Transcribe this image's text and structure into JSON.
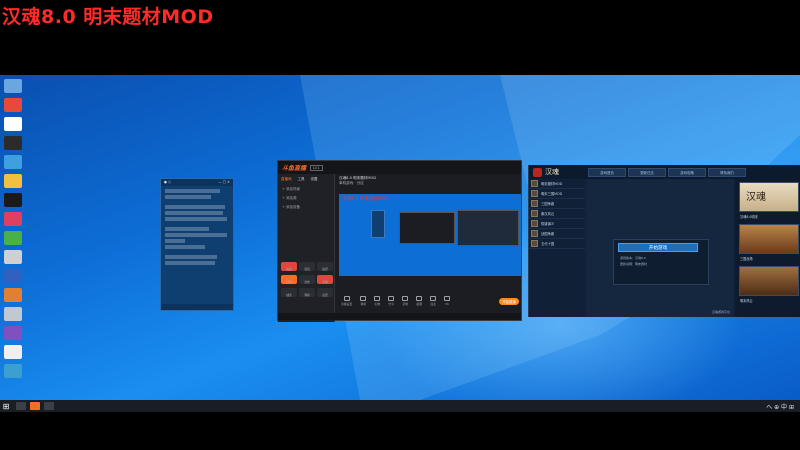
{
  "overlay": {
    "title": "汉魂8.0 明末题材MOD"
  },
  "taskbar": {
    "tray_text": "へ ⊕ 中 ⊞"
  },
  "chat": {
    "header_left": "● ○",
    "header_right": "— □ ✕"
  },
  "stream_app": {
    "logo": "斗鱼直播",
    "badge": "LV.1",
    "side_tabs": [
      "直播间",
      "工具",
      "设置"
    ],
    "side_rows": [
      "+ 添加场景",
      "+ 添加源",
      "+ 添加设备"
    ],
    "tools": [
      "美颜",
      "滤镜",
      "贴纸",
      "特效",
      "音效",
      "录像",
      "抽奖",
      "弹幕",
      "设置"
    ],
    "main_title": "汉魂8.0 明末题材MOD",
    "main_meta": "单机游戏 · 分区",
    "preview_text": "汉魂8.0 明末题材MOD",
    "bottom_tools": [
      "直播设置",
      "弹幕",
      "礼物",
      "分享",
      "录制",
      "截图",
      "连麦",
      "PK"
    ],
    "go_live": "开始直播"
  },
  "launcher": {
    "title": "汉魂",
    "nav": [
      "游戏首页",
      "更新日志",
      "游戏攻略",
      "联系我们"
    ],
    "side_items": [
      "明末题材MOD",
      "明末三国MOD",
      "三国争霸",
      "秦汉风云",
      "隋唐演义",
      "战国争霸",
      "五代十国"
    ],
    "start_button": "开始游戏",
    "rows": [
      "游戏版本：汉魂8.0",
      "更新说明：明末题材"
    ],
    "footer": "汉魂游戏平台",
    "cards": [
      {
        "big": "汉魂",
        "caption": "汉魂8.0明末"
      },
      {
        "big": "",
        "caption": "三国战场"
      },
      {
        "big": "",
        "caption": "明末风云"
      }
    ]
  }
}
